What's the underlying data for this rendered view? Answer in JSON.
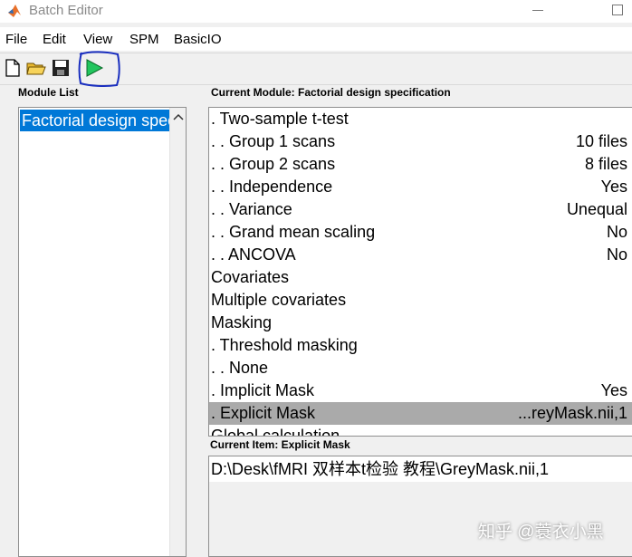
{
  "window": {
    "title": "Batch Editor"
  },
  "menu": [
    "File",
    "Edit",
    "View",
    "SPM",
    "BasicIO"
  ],
  "toolbar": {
    "icons": [
      "new-file-icon",
      "open-folder-icon",
      "save-icon",
      "run-icon"
    ],
    "accent": "#22c55e",
    "annotation_color": "#1a2fbf"
  },
  "module_list": {
    "label": "Module List",
    "items": [
      "Factorial design specification"
    ]
  },
  "current_module": {
    "label": "Current Module: Factorial design specification",
    "rows": [
      {
        "label": ". Two-sample t-test",
        "value": ""
      },
      {
        "label": ". . Group 1 scans",
        "value": "10 files"
      },
      {
        "label": ". . Group 2 scans",
        "value": "8 files"
      },
      {
        "label": ". . Independence",
        "value": "Yes"
      },
      {
        "label": ". . Variance",
        "value": "Unequal"
      },
      {
        "label": ". . Grand mean scaling",
        "value": "No"
      },
      {
        "label": ". . ANCOVA",
        "value": "No"
      },
      {
        "label": "Covariates",
        "value": ""
      },
      {
        "label": "Multiple covariates",
        "value": ""
      },
      {
        "label": "Masking",
        "value": ""
      },
      {
        "label": ". Threshold masking",
        "value": ""
      },
      {
        "label": ". . None",
        "value": ""
      },
      {
        "label": ". Implicit Mask",
        "value": "Yes"
      },
      {
        "label": ". Explicit Mask",
        "value": "...reyMask.nii,1"
      },
      {
        "label": "Global calculation",
        "value": ""
      }
    ],
    "selected_index": 13
  },
  "current_item": {
    "label": "Current Item: Explicit Mask",
    "value": "D:\\Desk\\fMRI 双样本t检验 教程\\GreyMask.nii,1"
  },
  "watermark": "知乎 @蓑衣小黑"
}
